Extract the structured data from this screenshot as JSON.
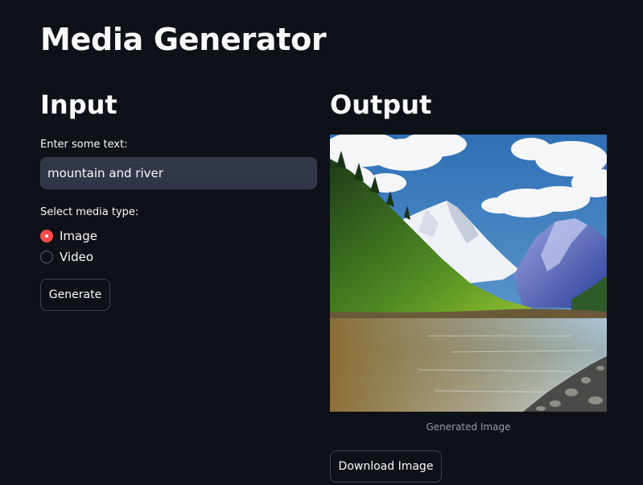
{
  "page": {
    "title": "Media Generator"
  },
  "input_section": {
    "title": "Input",
    "text_field": {
      "label": "Enter some text:",
      "value": "mountain and river"
    },
    "media_type": {
      "label": "Select media type:",
      "options": [
        {
          "label": "Image",
          "selected": true
        },
        {
          "label": "Video",
          "selected": false
        }
      ]
    },
    "generate_button": "Generate"
  },
  "output_section": {
    "title": "Output",
    "image_description": "Landscape of snowy mountains, forested hillside and a river",
    "caption": "Generated Image",
    "download_button": "Download Image"
  },
  "colors": {
    "background": "#0e1117",
    "accent": "#ff4b4b",
    "input_background": "#31364a",
    "border": "#3f4350",
    "caption_text": "#9a9ca4"
  }
}
